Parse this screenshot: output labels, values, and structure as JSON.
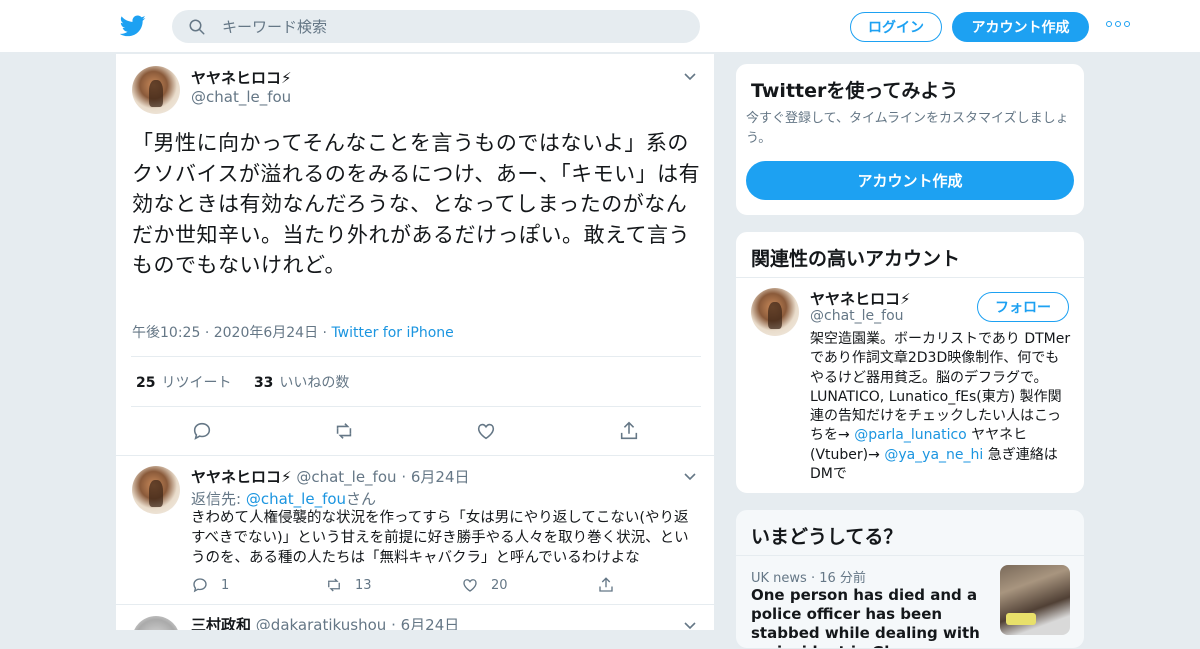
{
  "header": {
    "search_placeholder": "キーワード検索",
    "login_label": "ログイン",
    "signup_label": "アカウント作成"
  },
  "tweet": {
    "name": "ヤヤネヒロコ⚡",
    "handle": "@chat_le_fou",
    "text": "「男性に向かってそんなことを言うものではないよ」系のクソバイスが溢れるのをみるにつけ、あー、「キモい」は有効なときは有効なんだろうな、となってしまったのがなんだか世知辛い。当たり外れがあるだけっぽい。敢えて言うものでもないけれど。",
    "time": "午後10:25",
    "date": "2020年6月24日",
    "source": "Twitter for iPhone",
    "retweets_count": "25",
    "retweets_label": "リツイート",
    "likes_count": "33",
    "likes_label": "いいねの数"
  },
  "reply1": {
    "name": "ヤヤネヒロコ⚡",
    "handle": "@chat_le_fou",
    "date": "6月24日",
    "replyto_label": "返信先:",
    "replyto_handle": "@chat_le_fou",
    "replyto_suffix": "さん",
    "text": "きわめて人権侵襲的な状況を作ってすら「女は男にやり返してこない(やり返すべきでない)」という甘えを前提に好き勝手やる人々を取り巻く状況、というのを、ある種の人たちは「無料キャバクラ」と呼んでいるわけよな",
    "replies": "1",
    "retweets": "13",
    "likes": "20"
  },
  "reply2": {
    "name": "三村政和",
    "handle": "@dakaratikushou",
    "date": "6月24日"
  },
  "sidebar": {
    "join": {
      "title": "Twitterを使ってみよう",
      "sub": "今すぐ登録して、タイムラインをカスタマイズしましょう。",
      "button": "アカウント作成"
    },
    "related": {
      "title": "関連性の高いアカウント",
      "name": "ヤヤネヒロコ⚡",
      "handle": "@chat_le_fou",
      "follow": "フォロー",
      "bio_1": "架空造園業。ボーカリストであり",
      "bio_2": "DTMerであり作詞文章2D3D映像制作、何でもやるけど器用貧乏。脳のデフラグで。LUNATICO, Lunatico_fEs(東方) 製作関連の告知だけをチェックしたい人はこっちを→",
      "bio_link1": "@parla_lunatico",
      "bio_3": " ヤヤネヒ(Vtuber)→",
      "bio_link2": "@ya_ya_ne_hi",
      "bio_4": " 急ぎ連絡はDMで"
    },
    "trends": {
      "title": "いまどうしてる？",
      "meta_source": "UK news",
      "meta_time": "16 分前",
      "headline": "One person has died and a police officer has been stabbed while dealing with an incident in Glasgow"
    }
  },
  "colors": {
    "accent": "#1da1f2",
    "link": "#1b95e0",
    "muted": "#657786"
  }
}
